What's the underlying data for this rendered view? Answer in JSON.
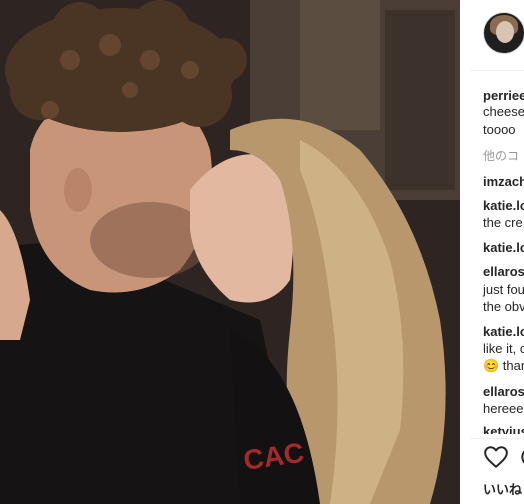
{
  "post": {
    "author": "perriee",
    "caption_lines": [
      "cheese",
      "toooo"
    ],
    "more_comments_label": "他のコ"
  },
  "comments": [
    {
      "user": "imzach",
      "lines": []
    },
    {
      "user": "katie.lo",
      "lines": [
        "the cre"
      ]
    },
    {
      "user": "katie.lo",
      "lines": []
    },
    {
      "user": "ellaros",
      "lines": [
        "just fou",
        "the obv"
      ]
    },
    {
      "user": "katie.lo",
      "lines": [
        "like it, c",
        "😊 thar"
      ]
    },
    {
      "user": "ellaros",
      "lines": [
        "hereee"
      ]
    },
    {
      "user": "ketyius",
      "lines": []
    }
  ],
  "actions": {
    "like_icon": "heart-icon",
    "comment_icon": "comment-icon",
    "likes_label": "いいね"
  },
  "colors": {
    "text": "#262626",
    "muted": "#999999",
    "divider": "#efefef"
  }
}
